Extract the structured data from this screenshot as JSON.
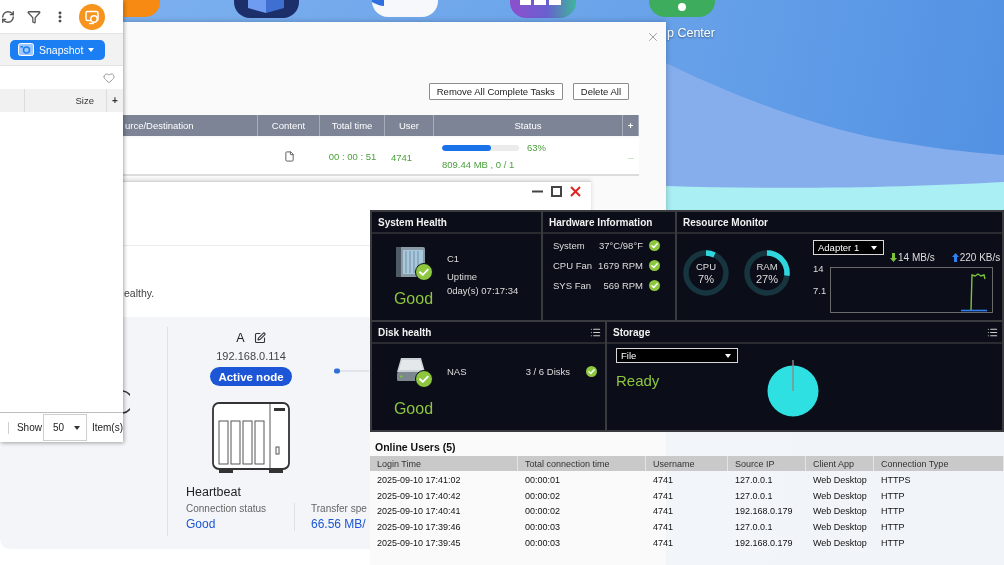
{
  "desktop": {
    "app_label": "p Center"
  },
  "file_panel": {
    "snapshot_button": "Snapshot",
    "size_column": "Size",
    "add_column": "+",
    "footer": {
      "show_label": "Show",
      "page_size": "50",
      "items_label": "Item(s)"
    }
  },
  "task_window": {
    "buttons": [
      "Remove All Complete Tasks",
      "Delete All"
    ],
    "columns": [
      "urce/Destination",
      "Content",
      "Total time",
      "User",
      "Status"
    ],
    "add_column": "+",
    "rows": [
      {
        "total_time": "00 : 00 : 51",
        "user": "4741",
        "level": 0.63,
        "percent": "63%",
        "transferred": "809.44 MB , 0 / 1",
        "more": "..."
      }
    ]
  },
  "cluster_window": {
    "message": "ealthy.",
    "node": {
      "name": "A",
      "ip": "192.168.0.114",
      "role": "Active node"
    },
    "heartbeat": {
      "title": "Heartbeat",
      "stats": [
        {
          "label": "Connection status",
          "value": "Good"
        },
        {
          "label": "Transfer spe",
          "value": "66.56 MB/"
        }
      ]
    }
  },
  "monitor": {
    "system_health": {
      "title": "System Health",
      "name": "C1",
      "uptime_label": "Uptime",
      "uptime": "0day(s) 07:17:34",
      "status": "Good"
    },
    "hardware": {
      "title": "Hardware Information",
      "items": [
        {
          "label": "System",
          "value": "37°C/98°F",
          "ok": true
        },
        {
          "label": "CPU Fan",
          "value": "1679 RPM",
          "ok": true
        },
        {
          "label": "SYS Fan",
          "value": "569 RPM",
          "ok": true
        }
      ]
    },
    "resource_monitor": {
      "title": "Resource Monitor",
      "gauges": [
        {
          "label": "CPU",
          "value": "7%",
          "level": 0.07
        },
        {
          "label": "RAM",
          "value": "27%",
          "level": 0.27
        }
      ],
      "adapter": "Adapter 1",
      "download": "14 MB/s",
      "upload": "220 KB/s",
      "axis_labels": [
        "14",
        "7.1"
      ]
    },
    "disk_health": {
      "title": "Disk health",
      "name": "NAS",
      "disks": "3 / 6 Disks",
      "ok": true,
      "status": "Good"
    },
    "storage": {
      "title": "Storage",
      "volume_type": "File",
      "status": "Ready"
    },
    "online_users": {
      "title": "Online Users (5)",
      "columns": [
        "Login Time",
        "Total connection time",
        "Username",
        "Source IP",
        "Client App",
        "Connection Type"
      ],
      "rows": [
        [
          "2025-09-10 17:41:02",
          "00:00:01",
          "4741",
          "127.0.0.1",
          "Web Desktop",
          "HTTPS"
        ],
        [
          "2025-09-10 17:40:42",
          "00:00:02",
          "4741",
          "127.0.0.1",
          "Web Desktop",
          "HTTP"
        ],
        [
          "2025-09-10 17:40:41",
          "00:00:02",
          "4741",
          "192.168.0.179",
          "Web Desktop",
          "HTTP"
        ],
        [
          "2025-09-10 17:39:46",
          "00:00:03",
          "4741",
          "127.0.0.1",
          "Web Desktop",
          "HTTP"
        ],
        [
          "2025-09-10 17:39:45",
          "00:00:03",
          "4741",
          "192.168.0.179",
          "Web Desktop",
          "HTTP"
        ]
      ]
    }
  }
}
